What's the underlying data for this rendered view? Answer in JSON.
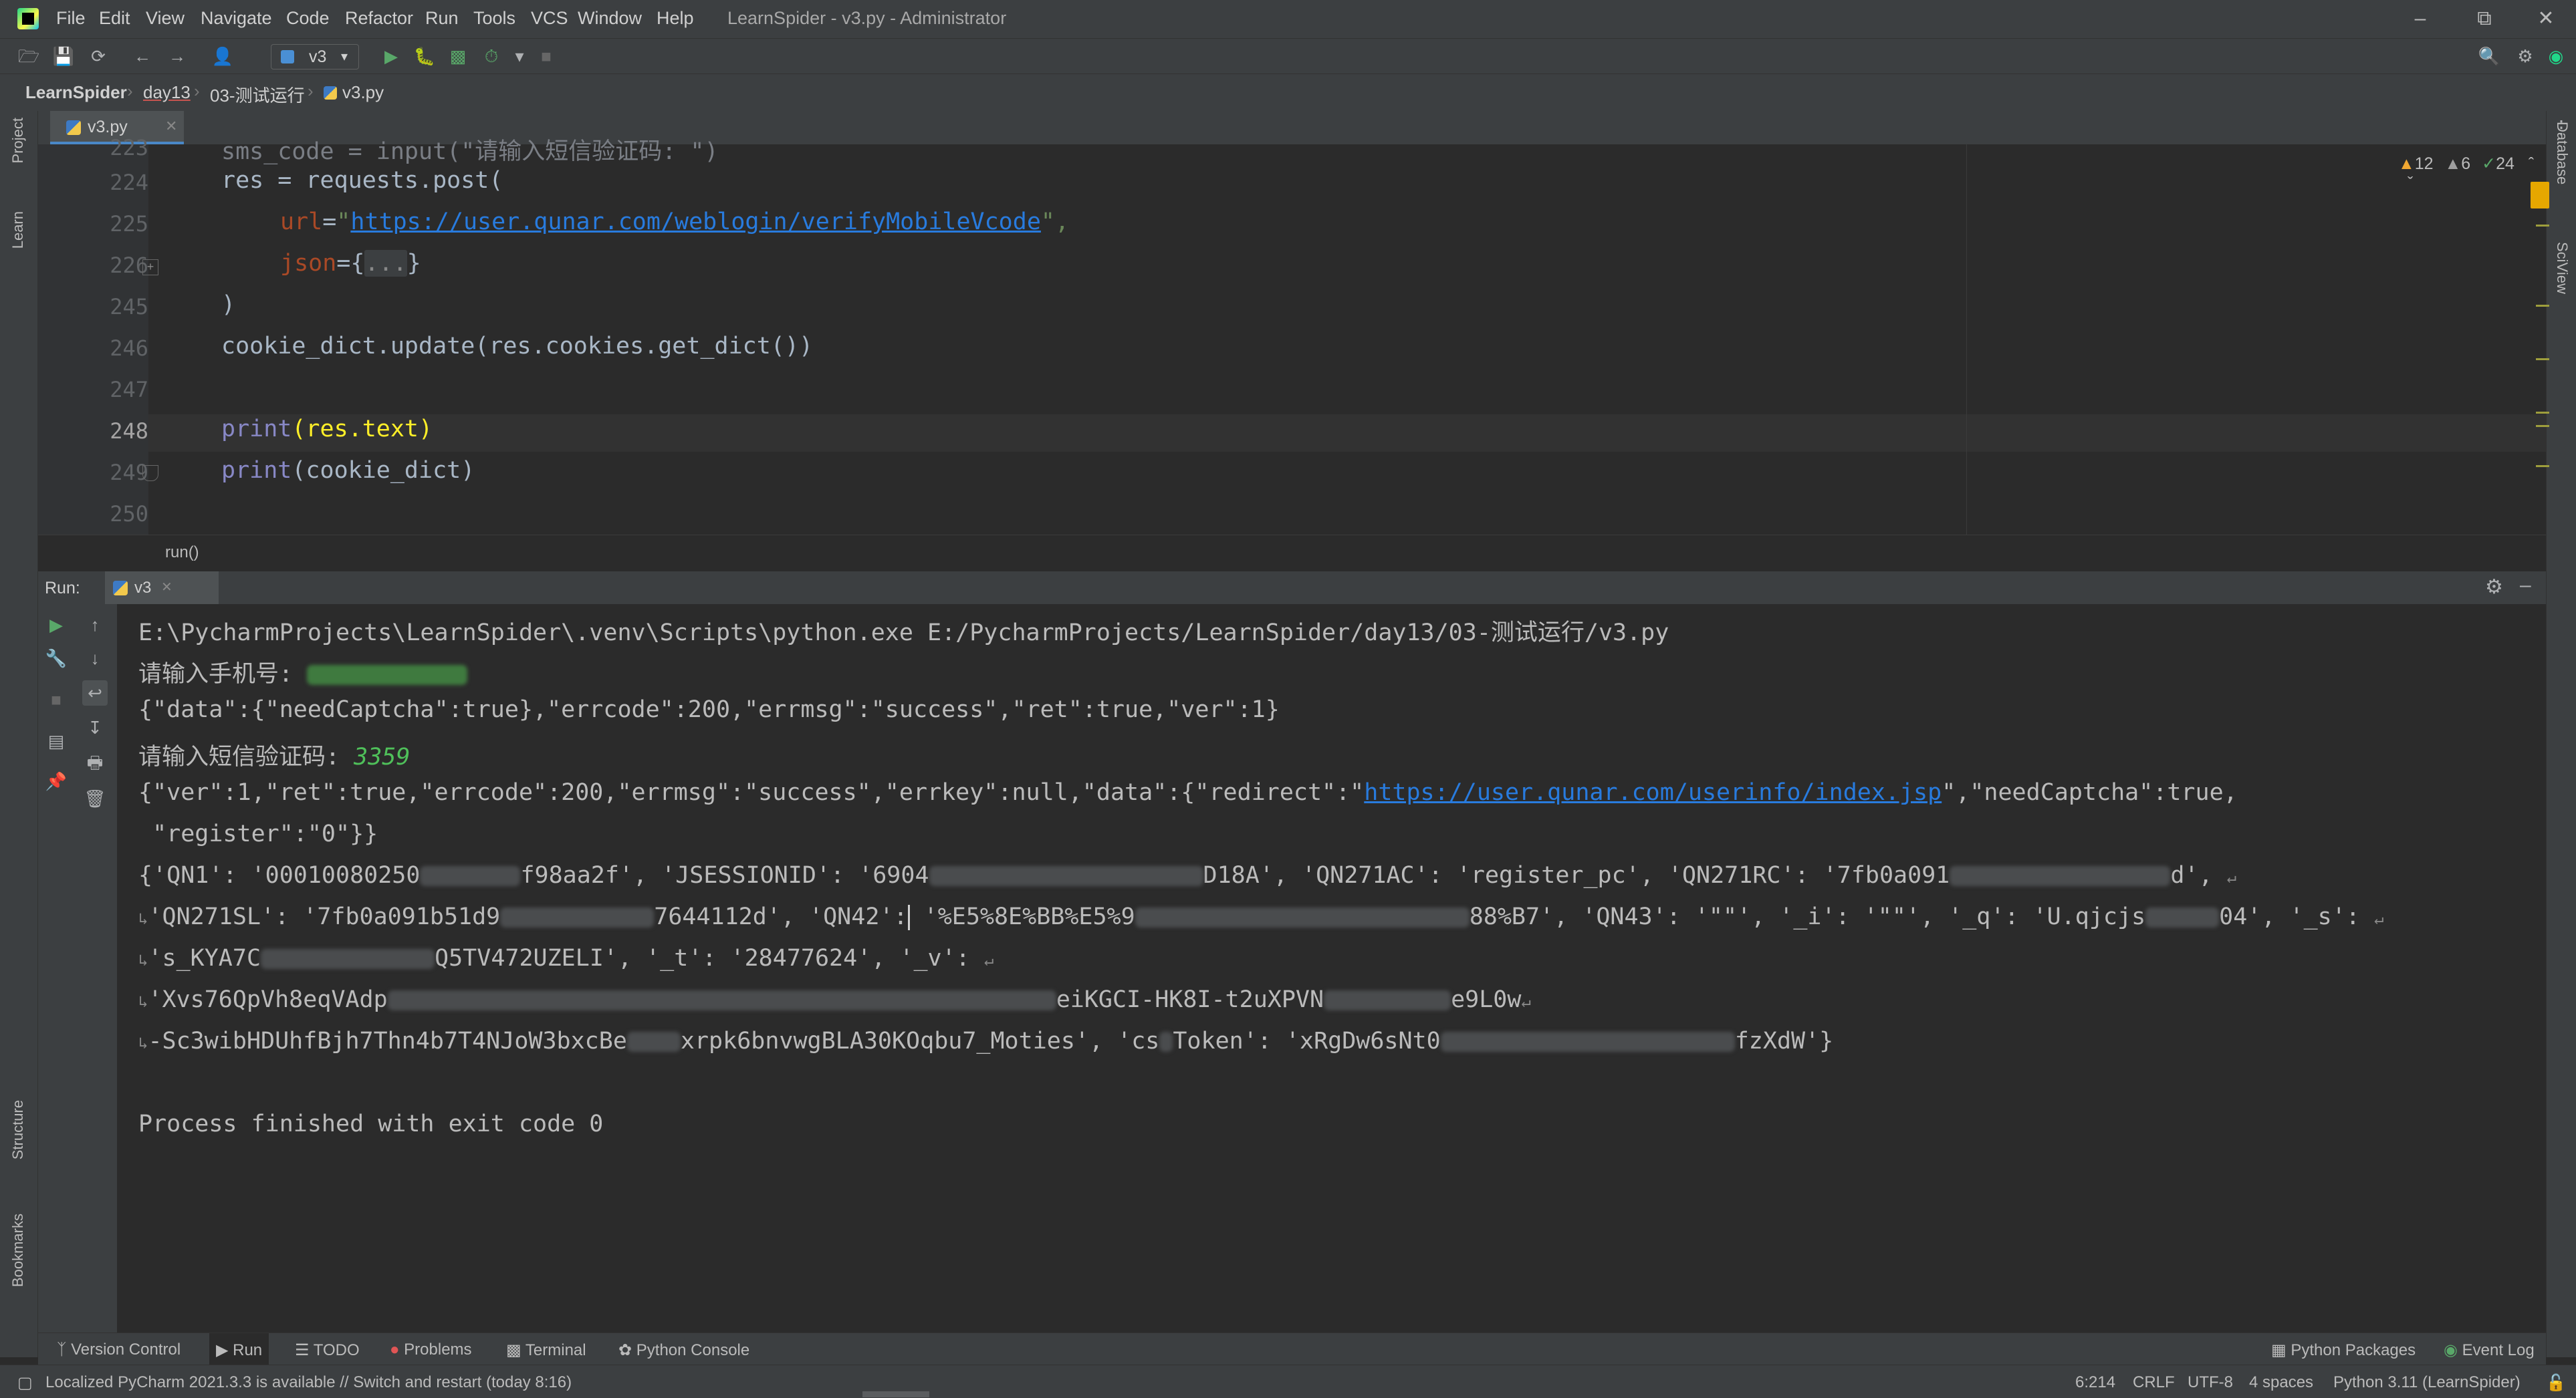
{
  "menubar": {
    "items": [
      "File",
      "Edit",
      "View",
      "Navigate",
      "Code",
      "Refactor",
      "Run",
      "Tools",
      "VCS",
      "Window",
      "Help"
    ],
    "title": "LearnSpider - v3.py - Administrator"
  },
  "toolbar": {
    "run_config": "v3"
  },
  "breadcrumbs": [
    "LearnSpider",
    "day13",
    "03-测试运行",
    "v3.py"
  ],
  "left_strip": {
    "project": "Project",
    "learn": "Learn",
    "structure": "Structure",
    "bookmarks": "Bookmarks"
  },
  "right_strip": {
    "database": "Database",
    "sciview": "SciView"
  },
  "editor": {
    "tab": "v3.py",
    "inspections": {
      "warnings": "12",
      "weak": "6",
      "typos": "24"
    },
    "lines": [
      {
        "num": "223",
        "text": "sms_code = input(\"请输入短信验证码: \")"
      },
      {
        "num": "224",
        "text": "res = requests.post("
      },
      {
        "num": "225",
        "param": "url",
        "eq": "=",
        "q1": "\"",
        "url": "https://user.qunar.com/weblogin/verifyMobileVcode",
        "q2": "\",",
        "text": ""
      },
      {
        "num": "226",
        "param": "json",
        "eq": "={",
        "fold": "...",
        "close": "}"
      },
      {
        "num": "245",
        "text": ")"
      },
      {
        "num": "246",
        "text": "cookie_dict.update(res.cookies.get_dict())"
      },
      {
        "num": "247",
        "text": ""
      },
      {
        "num": "248",
        "fn": "print",
        "arg": "(res.text)"
      },
      {
        "num": "249",
        "fn": "print",
        "arg": "(cookie_dict)"
      },
      {
        "num": "250",
        "text": ""
      }
    ],
    "breadcrumb": "run()"
  },
  "run_panel": {
    "title": "Run:",
    "tab": "v3",
    "console": {
      "cmd": "E:\\PycharmProjects\\LearnSpider\\.venv\\Scripts\\python.exe E:/PycharmProjects/LearnSpider/day13/03-测试运行/v3.py",
      "prompt_phone": "请输入手机号: ",
      "resp1": "{\"data\":{\"needCaptcha\":true},\"errcode\":200,\"errmsg\":\"success\",\"ret\":true,\"ver\":1}",
      "prompt_sms": "请输入短信验证码: ",
      "sms_code": "3359",
      "resp2_a": "{\"ver\":1,\"ret\":true,\"errcode\":200,\"errmsg\":\"success\",\"errkey\":null,\"data\":{\"redirect\":\"",
      "resp2_url": "https://user.qunar.com/userinfo/index.jsp",
      "resp2_b": "\",\"needCaptcha\":true,",
      "resp2_c": " \"register\":\"0\"}}",
      "cookies_1a": "{'QN1': '00010080250",
      "cookies_1b": "f98aa2f', 'JSESSIONID': '6904",
      "cookies_1c": "D18A', 'QN271AC': 'register_pc', 'QN271RC': '7fb0a091",
      "cookies_1d": "d',",
      "cookies_2a": "'QN271SL': '7fb0a091b51d9",
      "cookies_2b": "7644112d', 'QN42':",
      "cookies_2c": "'%E5%8E%BB%E5%9",
      "cookies_2d": "88%B7', 'QN43': '\"\"', '_i': '\"\"', '_q': 'U.qjcjs",
      "cookies_2e": "04', '_s':",
      "cookies_3a": "'s_KYA7C",
      "cookies_3b": "Q5TV472UZELI', '_t': '28477624', '_v':",
      "cookies_4a": "'Xvs76QpVh8eqVAdp",
      "cookies_4b": "eiKGCI-HK8I-t2uXPVN",
      "cookies_4c": "e9L0w",
      "cookies_5a": "-Sc3wibHDUhfBjh7Thn4b7T4NJoW3bxcBe",
      "cookies_5b": "xrpk6bnvwgBLA30KOqbu7_Moties', 'cs",
      "cookies_5c": "Token': 'xRgDw6sNt0",
      "cookies_5d": "fzXdW'}",
      "finished": "Process finished with exit code 0"
    }
  },
  "bottom_tools": [
    "Version Control",
    "Run",
    "TODO",
    "Problems",
    "Terminal",
    "Python Console"
  ],
  "bottom_tools_right": [
    "Python Packages",
    "Event Log"
  ],
  "status": {
    "message": "Localized PyCharm 2021.3.3 is available // Switch and restart (today 8:16)",
    "position": "6:214",
    "line_sep": "CRLF",
    "encoding": "UTF-8",
    "indent": "4 spaces",
    "interpreter": "Python 3.11 (LearnSpider)"
  }
}
